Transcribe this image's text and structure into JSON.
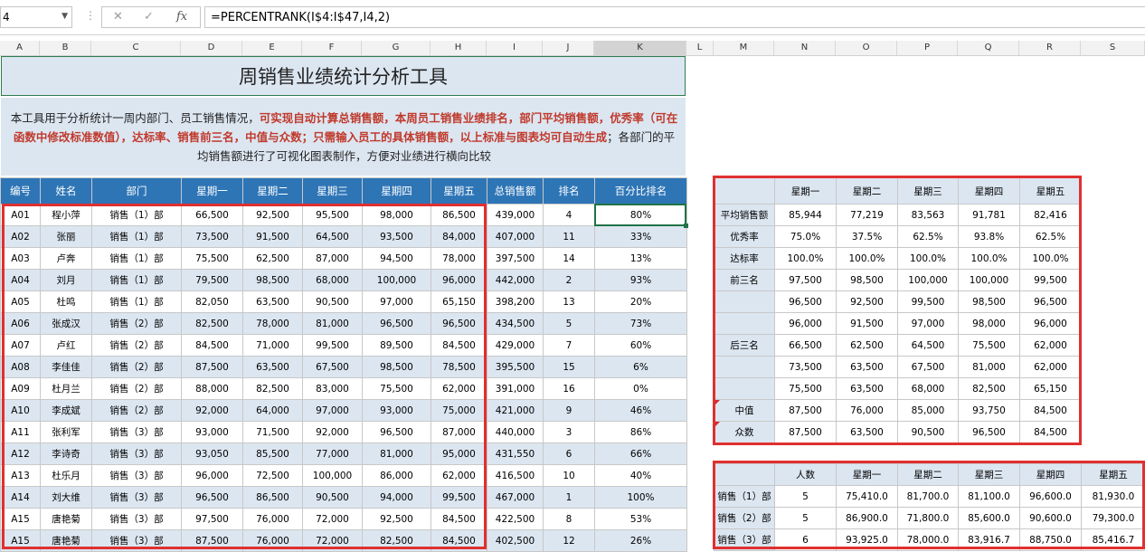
{
  "formula_bar": {
    "name_box": "4",
    "formula": "=PERCENTRANK(I$4:I$47,I4,2)",
    "cancel_icon": "✕",
    "enter_icon": "✓",
    "fx_icon": "fx"
  },
  "columns": [
    "A",
    "B",
    "C",
    "D",
    "E",
    "F",
    "G",
    "H",
    "I",
    "J",
    "K",
    "L",
    "M",
    "N",
    "O",
    "P",
    "Q",
    "R",
    "S"
  ],
  "title": "周销售业绩统计分析工具",
  "description": {
    "part1": "本工具用于分析统计一周内部门、员工销售情况，",
    "part2": "可实现自动计算总销售额，本周员工销售业绩排名，部门平均销售额，优秀率（可在函数中修改标准数值），达标率、销售前三名，中值与众数；只需输入员工的具体销售额，以上标准与图表均可自动生成",
    "part3": "；各部门的平均销售额进行了可视化图表制作，方便对业绩进行横向比较"
  },
  "main_table": {
    "headers": [
      "编号",
      "姓名",
      "部门",
      "星期一",
      "星期二",
      "星期三",
      "星期四",
      "星期五",
      "总销售额",
      "排名",
      "百分比排名"
    ],
    "rows": [
      [
        "A01",
        "程小萍",
        "销售（1）部",
        "66,500",
        "92,500",
        "95,500",
        "98,000",
        "86,500",
        "439,000",
        "4",
        "80%"
      ],
      [
        "A02",
        "张丽",
        "销售（1）部",
        "73,500",
        "91,500",
        "64,500",
        "93,500",
        "84,000",
        "407,000",
        "11",
        "33%"
      ],
      [
        "A03",
        "卢奔",
        "销售（1）部",
        "75,500",
        "62,500",
        "87,000",
        "94,500",
        "78,000",
        "397,500",
        "14",
        "13%"
      ],
      [
        "A04",
        "刘月",
        "销售（1）部",
        "79,500",
        "98,500",
        "68,000",
        "100,000",
        "96,000",
        "442,000",
        "2",
        "93%"
      ],
      [
        "A05",
        "杜鸣",
        "销售（1）部",
        "82,050",
        "63,500",
        "90,500",
        "97,000",
        "65,150",
        "398,200",
        "13",
        "20%"
      ],
      [
        "A06",
        "张成汉",
        "销售（2）部",
        "82,500",
        "78,000",
        "81,000",
        "96,500",
        "96,500",
        "434,500",
        "5",
        "73%"
      ],
      [
        "A07",
        "卢红",
        "销售（2）部",
        "84,500",
        "71,000",
        "99,500",
        "89,500",
        "84,500",
        "429,000",
        "7",
        "60%"
      ],
      [
        "A08",
        "李佳佳",
        "销售（2）部",
        "87,500",
        "63,500",
        "67,500",
        "98,500",
        "78,500",
        "395,500",
        "15",
        "6%"
      ],
      [
        "A09",
        "杜月兰",
        "销售（2）部",
        "88,000",
        "82,500",
        "83,000",
        "75,500",
        "62,000",
        "391,000",
        "16",
        "0%"
      ],
      [
        "A10",
        "李成斌",
        "销售（2）部",
        "92,000",
        "64,000",
        "97,000",
        "93,000",
        "75,000",
        "421,000",
        "9",
        "46%"
      ],
      [
        "A11",
        "张利军",
        "销售（3）部",
        "93,000",
        "71,500",
        "92,000",
        "96,500",
        "87,000",
        "440,000",
        "3",
        "86%"
      ],
      [
        "A12",
        "李诗奇",
        "销售（3）部",
        "93,050",
        "85,500",
        "77,000",
        "81,000",
        "95,000",
        "431,550",
        "6",
        "66%"
      ],
      [
        "A13",
        "杜乐月",
        "销售（3）部",
        "96,000",
        "72,500",
        "100,000",
        "86,000",
        "62,000",
        "416,500",
        "10",
        "40%"
      ],
      [
        "A14",
        "刘大维",
        "销售（3）部",
        "96,500",
        "86,500",
        "90,500",
        "94,000",
        "99,500",
        "467,000",
        "1",
        "100%"
      ],
      [
        "A15",
        "唐艳菊",
        "销售（3）部",
        "97,500",
        "76,000",
        "72,000",
        "92,500",
        "84,500",
        "422,500",
        "8",
        "53%"
      ],
      [
        "A15",
        "唐艳菊",
        "销售（3）部",
        "87,500",
        "76,000",
        "72,000",
        "82,500",
        "84,500",
        "402,500",
        "12",
        "26%"
      ]
    ]
  },
  "stats_table": {
    "headers": [
      "",
      "星期一",
      "星期二",
      "星期三",
      "星期四",
      "星期五"
    ],
    "rows": [
      [
        "平均销售额",
        "85,944",
        "77,219",
        "83,563",
        "91,781",
        "82,416"
      ],
      [
        "优秀率",
        "75.0%",
        "37.5%",
        "62.5%",
        "93.8%",
        "62.5%"
      ],
      [
        "达标率",
        "100.0%",
        "100.0%",
        "100.0%",
        "100.0%",
        "100.0%"
      ],
      [
        "前三名",
        "97,500",
        "98,500",
        "100,000",
        "100,000",
        "99,500"
      ],
      [
        "",
        "96,500",
        "92,500",
        "99,500",
        "98,500",
        "96,500"
      ],
      [
        "",
        "96,000",
        "91,500",
        "97,000",
        "98,000",
        "96,000"
      ],
      [
        "后三名",
        "66,500",
        "62,500",
        "64,500",
        "75,500",
        "62,000"
      ],
      [
        "",
        "73,500",
        "63,500",
        "67,500",
        "81,000",
        "62,000"
      ],
      [
        "",
        "75,500",
        "63,500",
        "68,000",
        "82,500",
        "65,150"
      ],
      [
        "中值",
        "87,500",
        "76,000",
        "85,000",
        "93,750",
        "84,500"
      ],
      [
        "众数",
        "87,500",
        "63,500",
        "90,500",
        "96,500",
        "84,500"
      ]
    ]
  },
  "dept_table": {
    "headers": [
      "",
      "人数",
      "星期一",
      "星期二",
      "星期三",
      "星期四",
      "星期五"
    ],
    "rows": [
      [
        "销售（1）部",
        "5",
        "75,410.0",
        "81,700.0",
        "81,100.0",
        "96,600.0",
        "81,930.0"
      ],
      [
        "销售（2）部",
        "5",
        "86,900.0",
        "71,800.0",
        "85,600.0",
        "90,600.0",
        "79,300.0"
      ],
      [
        "销售（3）部",
        "6",
        "93,925.0",
        "78,000.0",
        "83,916.7",
        "88,750.0",
        "85,416.7"
      ]
    ]
  },
  "colors": {
    "header_blue": "#2e75b6",
    "band_light": "#dce6f1",
    "highlight_red": "#e03030",
    "emphasis_text": "#c0392b"
  }
}
